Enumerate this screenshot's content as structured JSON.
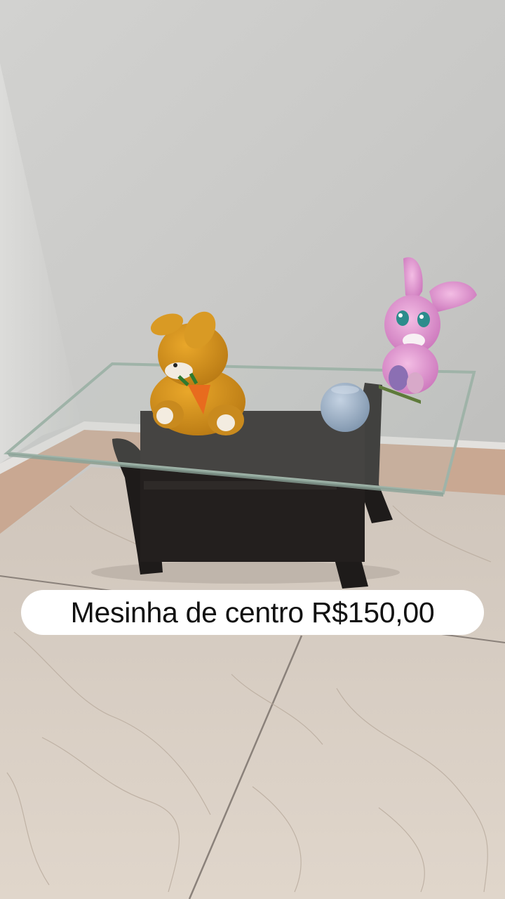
{
  "caption": {
    "text": "Mesinha de centro R$150,00"
  },
  "colors": {
    "wall": "#c9c9c7",
    "floor": "#d9cfc4",
    "table_wood": "#1e1b1a",
    "glass_edge": "#a7b7ad",
    "caption_bg": "#ffffff",
    "caption_text": "#111111"
  }
}
